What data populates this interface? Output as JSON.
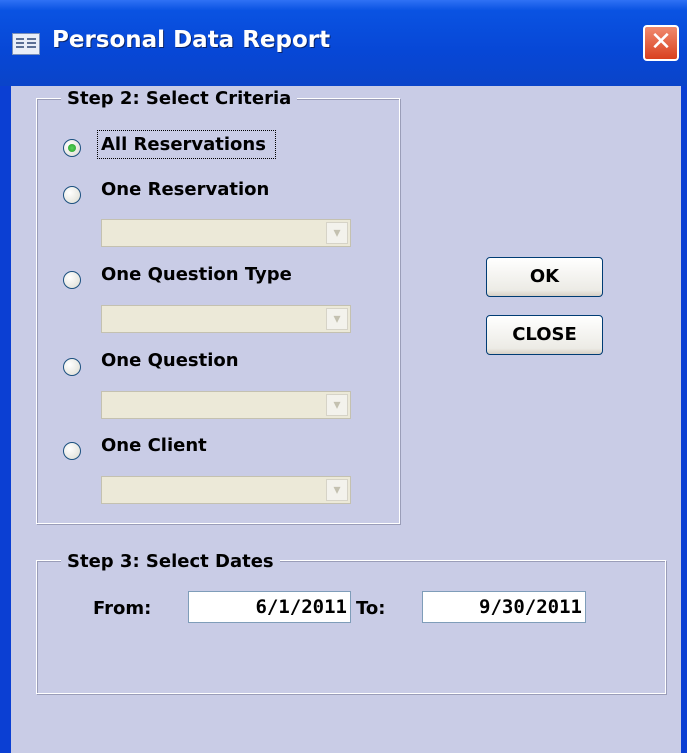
{
  "window": {
    "title": "Personal Data Report",
    "icon": "form-icon",
    "close_glyph": "✕"
  },
  "criteria": {
    "legend": "Step 2:  Select Criteria",
    "options": [
      {
        "label": "All Reservations",
        "checked": true
      },
      {
        "label": "One Reservation",
        "checked": false
      },
      {
        "label": "One Question Type",
        "checked": false
      },
      {
        "label": "One Question",
        "checked": false
      },
      {
        "label": "One Client",
        "checked": false
      }
    ],
    "dropdown_arrow": "▾"
  },
  "buttons": {
    "ok": "OK",
    "close": "CLOSE"
  },
  "dates": {
    "legend": "Step 3: Select Dates",
    "from_label": "From:",
    "from_value": "6/1/2011",
    "to_label": "To:",
    "to_value": "9/30/2011"
  },
  "colors": {
    "titlebar": "#0747d6",
    "client_bg": "#c9cce6",
    "radio_selected": "#2a9f2a"
  }
}
